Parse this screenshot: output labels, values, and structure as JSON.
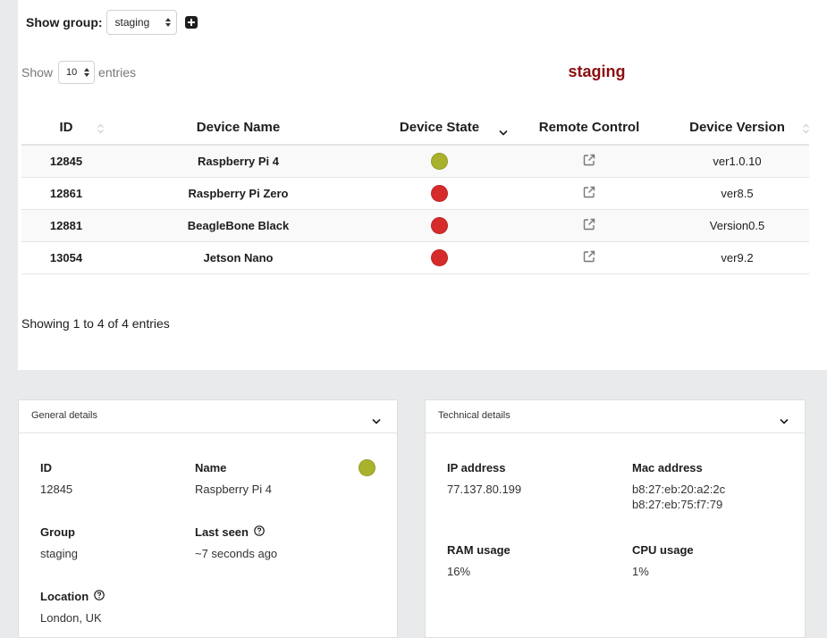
{
  "group_filter": {
    "label": "Show group:",
    "selected": "staging"
  },
  "table_controls": {
    "show_label": "Show",
    "length_value": "10",
    "entries_label": "entries"
  },
  "group_title": "staging",
  "table": {
    "headers": {
      "id": "ID",
      "name": "Device Name",
      "state": "Device State",
      "remote": "Remote Control",
      "version": "Device Version"
    },
    "rows": [
      {
        "id": "12845",
        "name": "Raspberry Pi 4",
        "state": "online",
        "version": "ver1.0.10"
      },
      {
        "id": "12861",
        "name": "Raspberry Pi Zero",
        "state": "offline",
        "version": "ver8.5"
      },
      {
        "id": "12881",
        "name": "BeagleBone Black",
        "state": "offline",
        "version": "Version0.5"
      },
      {
        "id": "13054",
        "name": "Jetson Nano",
        "state": "offline",
        "version": "ver9.2"
      }
    ],
    "info": "Showing 1 to 4 of 4 entries"
  },
  "colors": {
    "online": "#a9b22a",
    "offline": "#d62b2b",
    "group_title": "#8b0f0f"
  },
  "general_details": {
    "title": "General details",
    "id_label": "ID",
    "id_value": "12845",
    "name_label": "Name",
    "name_value": "Raspberry Pi 4",
    "group_label": "Group",
    "group_value": "staging",
    "last_seen_label": "Last seen",
    "last_seen_value": "~7 seconds ago",
    "location_label": "Location",
    "location_value": "London, UK",
    "status": "online"
  },
  "technical_details": {
    "title": "Technical details",
    "ip_label": "IP address",
    "ip_value": "77.137.80.199",
    "mac_label": "Mac address",
    "mac_values": [
      "b8:27:eb:20:a2:2c",
      "b8:27:eb:75:f7:79"
    ],
    "ram_label": "RAM usage",
    "ram_value": "16%",
    "cpu_label": "CPU usage",
    "cpu_value": "1%"
  },
  "icons": {
    "add": "plus-square-icon",
    "sort": "sort-icon",
    "remote": "external-link-icon",
    "collapse": "chevron-down-icon",
    "help": "question-circle-icon"
  }
}
